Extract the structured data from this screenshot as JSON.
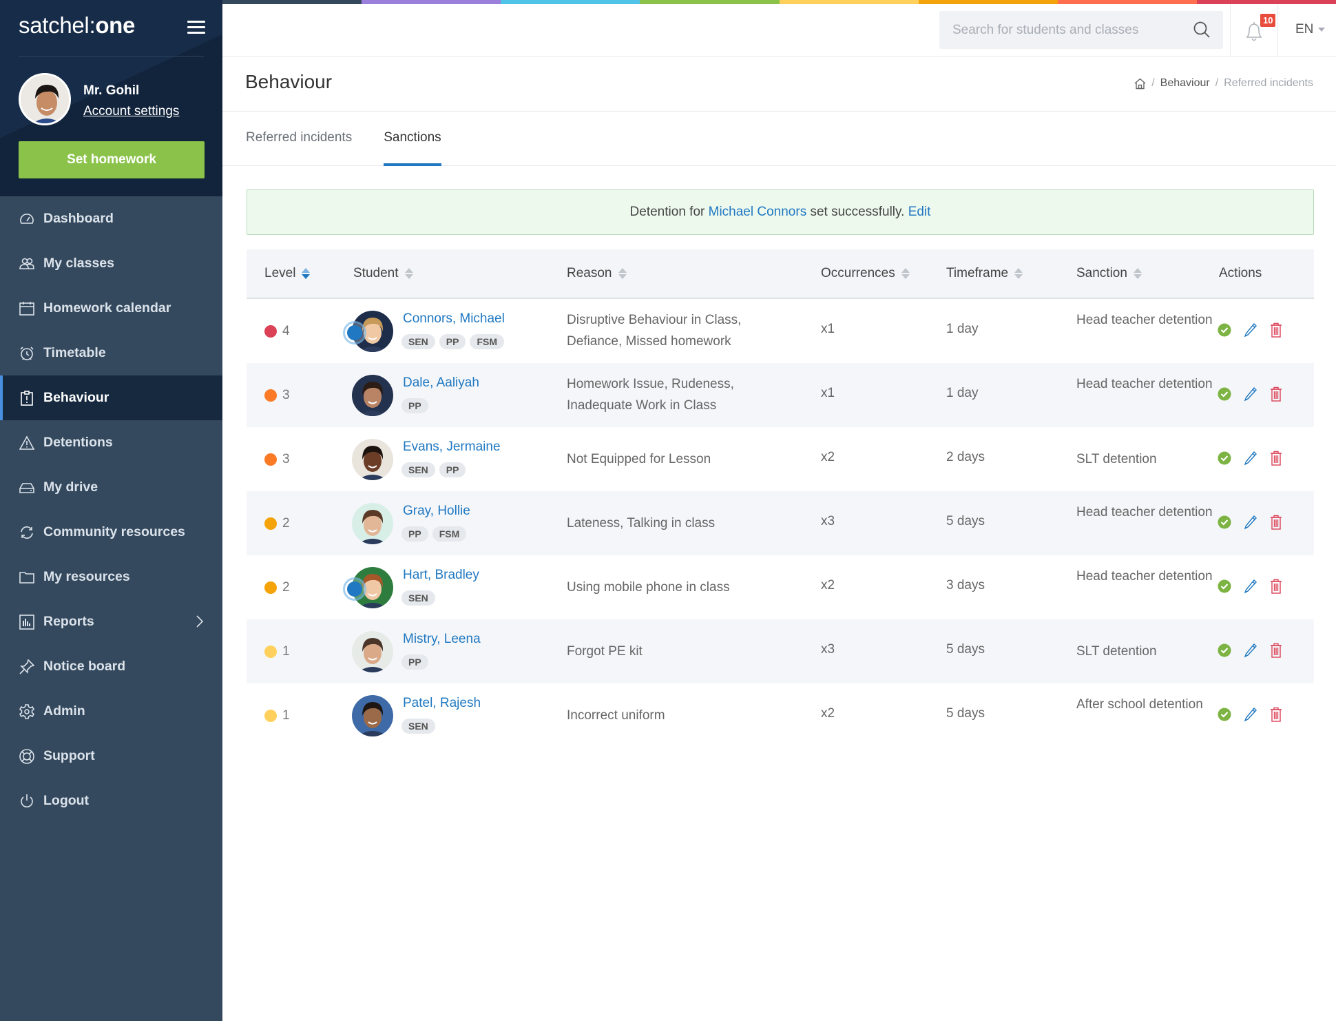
{
  "app": {
    "logo_light": "satchel:",
    "logo_bold": "one"
  },
  "user": {
    "name": "Mr. Gohil",
    "account_settings": "Account settings"
  },
  "sidebar": {
    "set_homework": "Set homework",
    "items": [
      {
        "label": "Dashboard",
        "icon": "dashboard-gauge-icon"
      },
      {
        "label": "My classes",
        "icon": "users-icon"
      },
      {
        "label": "Homework calendar",
        "icon": "calendar-icon"
      },
      {
        "label": "Timetable",
        "icon": "alarm-clock-icon"
      },
      {
        "label": "Behaviour",
        "icon": "clipboard-alert-icon",
        "active": true
      },
      {
        "label": "Detentions",
        "icon": "warning-triangle-icon"
      },
      {
        "label": "My drive",
        "icon": "hard-drive-icon"
      },
      {
        "label": "Community resources",
        "icon": "refresh-icon"
      },
      {
        "label": "My resources",
        "icon": "folder-icon"
      },
      {
        "label": "Reports",
        "icon": "bar-chart-icon",
        "has_submenu": true
      },
      {
        "label": "Notice board",
        "icon": "pin-icon"
      },
      {
        "label": "Admin",
        "icon": "gear-icon"
      },
      {
        "label": "Support",
        "icon": "lifebuoy-icon"
      },
      {
        "label": "Logout",
        "icon": "power-icon"
      }
    ]
  },
  "header": {
    "search_placeholder": "Search for students and classes",
    "search_value": "",
    "notification_count": "10",
    "language": "EN",
    "rainbow_colors": [
      "#34495e",
      "#9b7fdc",
      "#4fc3e8",
      "#8bc34a",
      "#ffd15c",
      "#f5a30a",
      "#ff6e4e",
      "#dc4257"
    ]
  },
  "page": {
    "title": "Behaviour",
    "breadcrumb": {
      "section": "Behaviour",
      "current": "Referred incidents"
    },
    "tabs": [
      {
        "label": "Referred incidents",
        "active": false
      },
      {
        "label": "Sanctions",
        "active": true
      }
    ]
  },
  "alert": {
    "prefix": "Detention for ",
    "student_link": "Michael Connors",
    "suffix": " set successfully. ",
    "edit_link": "Edit"
  },
  "table": {
    "columns": {
      "level": "Level",
      "student": "Student",
      "reason": "Reason",
      "occurrences": "Occurrences",
      "timeframe": "Timeframe",
      "sanction": "Sanction",
      "actions": "Actions"
    },
    "sorted_by": "Level",
    "level_colors": {
      "4": "#dc4257",
      "3": "#fa7a25",
      "2": "#f5a30a",
      "1": "#ffd15c"
    },
    "rows": [
      {
        "level": "4",
        "name": "Connors, Michael",
        "tags": [
          "SEN",
          "PP",
          "FSM"
        ],
        "reason": "Disruptive Behaviour in Class, Defiance, Missed homework",
        "occurrences": "x1",
        "timeframe": "1 day",
        "sanction": "Head teacher detention",
        "status_indicator": true,
        "avatar_colors": [
          "#c79a5a",
          "#f0c9a4",
          "#1e2d4a"
        ]
      },
      {
        "level": "3",
        "name": "Dale, Aaliyah",
        "tags": [
          "PP"
        ],
        "reason": "Homework Issue, Rudeness, Inadequate Work in Class",
        "occurrences": "x1",
        "timeframe": "1 day",
        "sanction": "Head teacher detention",
        "status_indicator": false,
        "avatar_colors": [
          "#2b1d16",
          "#b98466",
          "#23324f"
        ]
      },
      {
        "level": "3",
        "name": "Evans, Jermaine",
        "tags": [
          "SEN",
          "PP"
        ],
        "reason": "Not Equipped for Lesson",
        "occurrences": "x2",
        "timeframe": "2 days",
        "sanction": "SLT detention",
        "status_indicator": false,
        "avatar_colors": [
          "#1c130f",
          "#6b3d26",
          "#e9e4dc"
        ]
      },
      {
        "level": "2",
        "name": "Gray, Hollie",
        "tags": [
          "PP",
          "FSM"
        ],
        "reason": "Lateness, Talking in class",
        "occurrences": "x3",
        "timeframe": "5 days",
        "sanction": "Head teacher detention",
        "status_indicator": false,
        "avatar_colors": [
          "#5a3a26",
          "#e2b797",
          "#d8efe8"
        ]
      },
      {
        "level": "2",
        "name": "Hart, Bradley",
        "tags": [
          "SEN"
        ],
        "reason": "Using mobile phone in class",
        "occurrences": "x2",
        "timeframe": "3 days",
        "sanction": "Head teacher detention",
        "status_indicator": true,
        "avatar_colors": [
          "#a6582a",
          "#f1c8a6",
          "#2e7d3f"
        ]
      },
      {
        "level": "1",
        "name": "Mistry, Leena",
        "tags": [
          "PP"
        ],
        "reason": "Forgot PE kit",
        "occurrences": "x3",
        "timeframe": "5 days",
        "sanction": "SLT detention",
        "status_indicator": false,
        "avatar_colors": [
          "#4a3528",
          "#d9a988",
          "#e6ebe8"
        ]
      },
      {
        "level": "1",
        "name": "Patel, Rajesh",
        "tags": [
          "SEN"
        ],
        "reason": "Incorrect uniform",
        "occurrences": "x2",
        "timeframe": "5 days",
        "sanction": "After school detention",
        "status_indicator": false,
        "avatar_colors": [
          "#1d1612",
          "#9b6a48",
          "#3e6aa8"
        ]
      }
    ]
  }
}
